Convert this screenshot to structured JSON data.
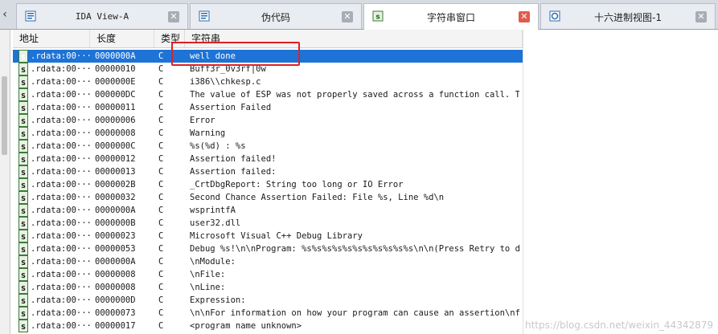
{
  "tabs": [
    {
      "label": "IDA View-A",
      "icon": "ida-view-icon",
      "active": false
    },
    {
      "label": "伪代码",
      "icon": "pseudocode-icon",
      "active": false
    },
    {
      "label": "字符串窗口",
      "icon": "strings-icon",
      "active": true
    },
    {
      "label": "十六进制视图-1",
      "icon": "hex-view-icon",
      "active": false
    }
  ],
  "columns": {
    "address": "地址",
    "length": "长度",
    "type": "类型",
    "string": "字符串"
  },
  "rows": [
    {
      "addr": ".rdata:00···",
      "len": "0000000A",
      "type": "C",
      "str": "well done"
    },
    {
      "addr": ".rdata:00···",
      "len": "00000010",
      "type": "C",
      "str": "Buff3r_0v3rf|0w"
    },
    {
      "addr": ".rdata:00···",
      "len": "0000000E",
      "type": "C",
      "str": "i386\\\\chkesp.c"
    },
    {
      "addr": ".rdata:00···",
      "len": "000000DC",
      "type": "C",
      "str": "The value of ESP was not properly saved across a function call.  T···"
    },
    {
      "addr": ".rdata:00···",
      "len": "00000011",
      "type": "C",
      "str": "Assertion Failed"
    },
    {
      "addr": ".rdata:00···",
      "len": "00000006",
      "type": "C",
      "str": "Error"
    },
    {
      "addr": ".rdata:00···",
      "len": "00000008",
      "type": "C",
      "str": "Warning"
    },
    {
      "addr": ".rdata:00···",
      "len": "0000000C",
      "type": "C",
      "str": "%s(%d) : %s"
    },
    {
      "addr": ".rdata:00···",
      "len": "00000012",
      "type": "C",
      "str": "Assertion failed!"
    },
    {
      "addr": ".rdata:00···",
      "len": "00000013",
      "type": "C",
      "str": "Assertion failed:"
    },
    {
      "addr": ".rdata:00···",
      "len": "0000002B",
      "type": "C",
      "str": "_CrtDbgReport: String too long or IO Error"
    },
    {
      "addr": ".rdata:00···",
      "len": "00000032",
      "type": "C",
      "str": "Second Chance Assertion Failed: File %s, Line %d\\n"
    },
    {
      "addr": ".rdata:00···",
      "len": "0000000A",
      "type": "C",
      "str": "wsprintfA"
    },
    {
      "addr": ".rdata:00···",
      "len": "0000000B",
      "type": "C",
      "str": "user32.dll"
    },
    {
      "addr": ".rdata:00···",
      "len": "00000023",
      "type": "C",
      "str": "Microsoft Visual C++ Debug Library"
    },
    {
      "addr": ".rdata:00···",
      "len": "00000053",
      "type": "C",
      "str": "Debug %s!\\n\\nProgram: %s%s%s%s%s%s%s%s%s%s%s\\n\\n(Press Retry to de···"
    },
    {
      "addr": ".rdata:00···",
      "len": "0000000A",
      "type": "C",
      "str": "\\nModule:"
    },
    {
      "addr": ".rdata:00···",
      "len": "00000008",
      "type": "C",
      "str": "\\nFile:"
    },
    {
      "addr": ".rdata:00···",
      "len": "00000008",
      "type": "C",
      "str": "\\nLine:"
    },
    {
      "addr": ".rdata:00···",
      "len": "0000000D",
      "type": "C",
      "str": "Expression:"
    },
    {
      "addr": ".rdata:00···",
      "len": "00000073",
      "type": "C",
      "str": "\\n\\nFor information on how your program can cause an assertion\\nfa···"
    },
    {
      "addr": ".rdata:00···",
      "len": "00000017",
      "type": "C",
      "str": "<program name unknown>"
    }
  ],
  "row_icon_glyph": "s",
  "selected_index": 0,
  "close_glyph": "✕",
  "watermark": "https://blog.csdn.net/weixin_44342879",
  "colors": {
    "selection": "#1e73d6",
    "highlight_box": "#e02020",
    "active_close": "#e35a4a"
  }
}
